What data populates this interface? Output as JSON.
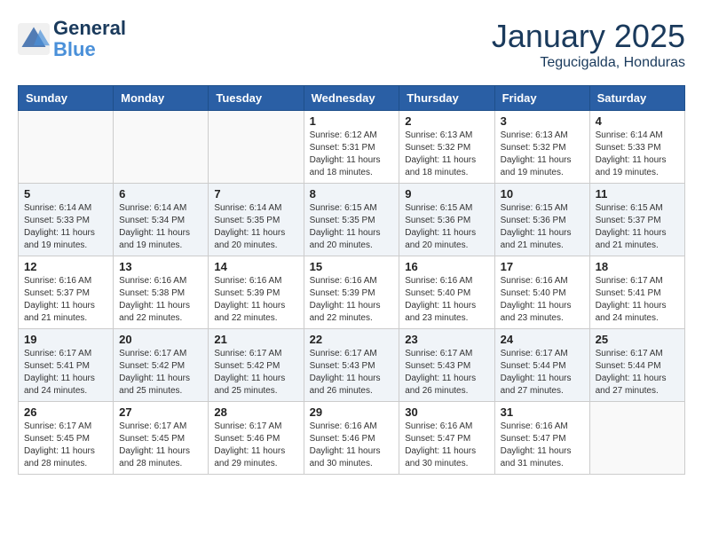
{
  "header": {
    "logo_line1": "General",
    "logo_line2": "Blue",
    "month": "January 2025",
    "location": "Tegucigalda, Honduras"
  },
  "weekdays": [
    "Sunday",
    "Monday",
    "Tuesday",
    "Wednesday",
    "Thursday",
    "Friday",
    "Saturday"
  ],
  "weeks": [
    [
      {
        "day": "",
        "info": ""
      },
      {
        "day": "",
        "info": ""
      },
      {
        "day": "",
        "info": ""
      },
      {
        "day": "1",
        "info": "Sunrise: 6:12 AM\nSunset: 5:31 PM\nDaylight: 11 hours\nand 18 minutes."
      },
      {
        "day": "2",
        "info": "Sunrise: 6:13 AM\nSunset: 5:32 PM\nDaylight: 11 hours\nand 18 minutes."
      },
      {
        "day": "3",
        "info": "Sunrise: 6:13 AM\nSunset: 5:32 PM\nDaylight: 11 hours\nand 19 minutes."
      },
      {
        "day": "4",
        "info": "Sunrise: 6:14 AM\nSunset: 5:33 PM\nDaylight: 11 hours\nand 19 minutes."
      }
    ],
    [
      {
        "day": "5",
        "info": "Sunrise: 6:14 AM\nSunset: 5:33 PM\nDaylight: 11 hours\nand 19 minutes."
      },
      {
        "day": "6",
        "info": "Sunrise: 6:14 AM\nSunset: 5:34 PM\nDaylight: 11 hours\nand 19 minutes."
      },
      {
        "day": "7",
        "info": "Sunrise: 6:14 AM\nSunset: 5:35 PM\nDaylight: 11 hours\nand 20 minutes."
      },
      {
        "day": "8",
        "info": "Sunrise: 6:15 AM\nSunset: 5:35 PM\nDaylight: 11 hours\nand 20 minutes."
      },
      {
        "day": "9",
        "info": "Sunrise: 6:15 AM\nSunset: 5:36 PM\nDaylight: 11 hours\nand 20 minutes."
      },
      {
        "day": "10",
        "info": "Sunrise: 6:15 AM\nSunset: 5:36 PM\nDaylight: 11 hours\nand 21 minutes."
      },
      {
        "day": "11",
        "info": "Sunrise: 6:15 AM\nSunset: 5:37 PM\nDaylight: 11 hours\nand 21 minutes."
      }
    ],
    [
      {
        "day": "12",
        "info": "Sunrise: 6:16 AM\nSunset: 5:37 PM\nDaylight: 11 hours\nand 21 minutes."
      },
      {
        "day": "13",
        "info": "Sunrise: 6:16 AM\nSunset: 5:38 PM\nDaylight: 11 hours\nand 22 minutes."
      },
      {
        "day": "14",
        "info": "Sunrise: 6:16 AM\nSunset: 5:39 PM\nDaylight: 11 hours\nand 22 minutes."
      },
      {
        "day": "15",
        "info": "Sunrise: 6:16 AM\nSunset: 5:39 PM\nDaylight: 11 hours\nand 22 minutes."
      },
      {
        "day": "16",
        "info": "Sunrise: 6:16 AM\nSunset: 5:40 PM\nDaylight: 11 hours\nand 23 minutes."
      },
      {
        "day": "17",
        "info": "Sunrise: 6:16 AM\nSunset: 5:40 PM\nDaylight: 11 hours\nand 23 minutes."
      },
      {
        "day": "18",
        "info": "Sunrise: 6:17 AM\nSunset: 5:41 PM\nDaylight: 11 hours\nand 24 minutes."
      }
    ],
    [
      {
        "day": "19",
        "info": "Sunrise: 6:17 AM\nSunset: 5:41 PM\nDaylight: 11 hours\nand 24 minutes."
      },
      {
        "day": "20",
        "info": "Sunrise: 6:17 AM\nSunset: 5:42 PM\nDaylight: 11 hours\nand 25 minutes."
      },
      {
        "day": "21",
        "info": "Sunrise: 6:17 AM\nSunset: 5:42 PM\nDaylight: 11 hours\nand 25 minutes."
      },
      {
        "day": "22",
        "info": "Sunrise: 6:17 AM\nSunset: 5:43 PM\nDaylight: 11 hours\nand 26 minutes."
      },
      {
        "day": "23",
        "info": "Sunrise: 6:17 AM\nSunset: 5:43 PM\nDaylight: 11 hours\nand 26 minutes."
      },
      {
        "day": "24",
        "info": "Sunrise: 6:17 AM\nSunset: 5:44 PM\nDaylight: 11 hours\nand 27 minutes."
      },
      {
        "day": "25",
        "info": "Sunrise: 6:17 AM\nSunset: 5:44 PM\nDaylight: 11 hours\nand 27 minutes."
      }
    ],
    [
      {
        "day": "26",
        "info": "Sunrise: 6:17 AM\nSunset: 5:45 PM\nDaylight: 11 hours\nand 28 minutes."
      },
      {
        "day": "27",
        "info": "Sunrise: 6:17 AM\nSunset: 5:45 PM\nDaylight: 11 hours\nand 28 minutes."
      },
      {
        "day": "28",
        "info": "Sunrise: 6:17 AM\nSunset: 5:46 PM\nDaylight: 11 hours\nand 29 minutes."
      },
      {
        "day": "29",
        "info": "Sunrise: 6:16 AM\nSunset: 5:46 PM\nDaylight: 11 hours\nand 30 minutes."
      },
      {
        "day": "30",
        "info": "Sunrise: 6:16 AM\nSunset: 5:47 PM\nDaylight: 11 hours\nand 30 minutes."
      },
      {
        "day": "31",
        "info": "Sunrise: 6:16 AM\nSunset: 5:47 PM\nDaylight: 11 hours\nand 31 minutes."
      },
      {
        "day": "",
        "info": ""
      }
    ]
  ]
}
